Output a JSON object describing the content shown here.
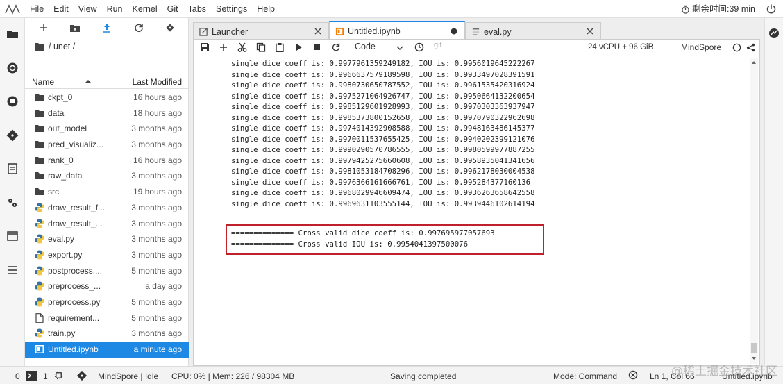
{
  "menu": {
    "items": [
      "File",
      "Edit",
      "View",
      "Run",
      "Kernel",
      "Git",
      "Tabs",
      "Settings",
      "Help"
    ],
    "timer": "剩余时间:39 min"
  },
  "file_browser": {
    "path": "/ unet /",
    "header": {
      "name": "Name",
      "modified": "Last Modified"
    },
    "files": [
      {
        "name": "ckpt_0",
        "modified": "16 hours ago",
        "icon": "folder-icon"
      },
      {
        "name": "data",
        "modified": "18 hours ago",
        "icon": "folder-icon"
      },
      {
        "name": "out_model",
        "modified": "3 months ago",
        "icon": "folder-icon"
      },
      {
        "name": "pred_visualiz...",
        "modified": "3 months ago",
        "icon": "folder-icon"
      },
      {
        "name": "rank_0",
        "modified": "16 hours ago",
        "icon": "folder-icon"
      },
      {
        "name": "raw_data",
        "modified": "3 months ago",
        "icon": "folder-icon"
      },
      {
        "name": "src",
        "modified": "19 hours ago",
        "icon": "folder-icon"
      },
      {
        "name": "draw_result_f...",
        "modified": "3 months ago",
        "icon": "python-icon"
      },
      {
        "name": "draw_result_...",
        "modified": "3 months ago",
        "icon": "python-icon"
      },
      {
        "name": "eval.py",
        "modified": "3 months ago",
        "icon": "python-icon"
      },
      {
        "name": "export.py",
        "modified": "3 months ago",
        "icon": "python-icon"
      },
      {
        "name": "postprocess....",
        "modified": "5 months ago",
        "icon": "python-icon"
      },
      {
        "name": "preprocess_...",
        "modified": "a day ago",
        "icon": "python-icon"
      },
      {
        "name": "preprocess.py",
        "modified": "5 months ago",
        "icon": "python-icon"
      },
      {
        "name": "requirement...",
        "modified": "5 months ago",
        "icon": "file-icon"
      },
      {
        "name": "train.py",
        "modified": "3 months ago",
        "icon": "python-icon"
      },
      {
        "name": "Untitled.ipynb",
        "modified": "a minute ago",
        "icon": "notebook-icon",
        "selected": true
      }
    ]
  },
  "tabs": [
    {
      "label": "Launcher",
      "active": false
    },
    {
      "label": "Untitled.ipynb",
      "active": true
    },
    {
      "label": "eval.py",
      "active": false
    }
  ],
  "notebook_toolbar": {
    "cell_type": "Code",
    "git": "git",
    "resources": "24 vCPU + 96 GiB",
    "kernel": "MindSpore"
  },
  "output_lines": [
    "single dice coeff is: 0.9977961359249182, IOU is: 0.9956019645222267",
    "single dice coeff is: 0.9966637579189598, IOU is: 0.9933497028391591",
    "single dice coeff is: 0.9980730650787552, IOU is: 0.9961535420316924",
    "single dice coeff is: 0.9975271064926747, IOU is: 0.9950664132200654",
    "single dice coeff is: 0.9985129601928993, IOU is: 0.9970303363937947",
    "single dice coeff is: 0.9985373800152658, IOU is: 0.9970790322962698",
    "single dice coeff is: 0.9974014392908588, IOU is: 0.9948163486145377",
    "single dice coeff is: 0.9970011537655425, IOU is: 0.9940202399121076",
    "single dice coeff is: 0.9990290570786555, IOU is: 0.9980599977887255",
    "single dice coeff is: 0.9979425275660608, IOU is: 0.9958935041341656",
    "single dice coeff is: 0.9981053184708296, IOU is: 0.9962178030004538",
    "single dice coeff is: 0.9976366161666761, IOU is: 0.995284377160136",
    "single dice coeff is: 0.9968029946609474, IOU is: 0.9936263658642558",
    "single dice coeff is: 0.9969631103555144, IOU is: 0.9939446102614194"
  ],
  "cross_valid": [
    "============== Cross valid dice coeff is: 0.997695977057693",
    "============== Cross valid IOU is: 0.9954041397500076"
  ],
  "status_bar": {
    "mode_zero": "0",
    "terminals": "1",
    "kernel_status": "MindSpore | Idle",
    "resources": "CPU: 0% | Mem: 226 / 98304 MB",
    "saving": "Saving completed",
    "mode": "Mode: Command",
    "position": "Ln 1, Col 66",
    "filename": "Untitled.ipynb"
  },
  "watermark": "@稀土掘金技术社区",
  "colors": {
    "accent": "#1e88e5",
    "highlight_box": "#c0202a",
    "python": "#3572a5"
  }
}
